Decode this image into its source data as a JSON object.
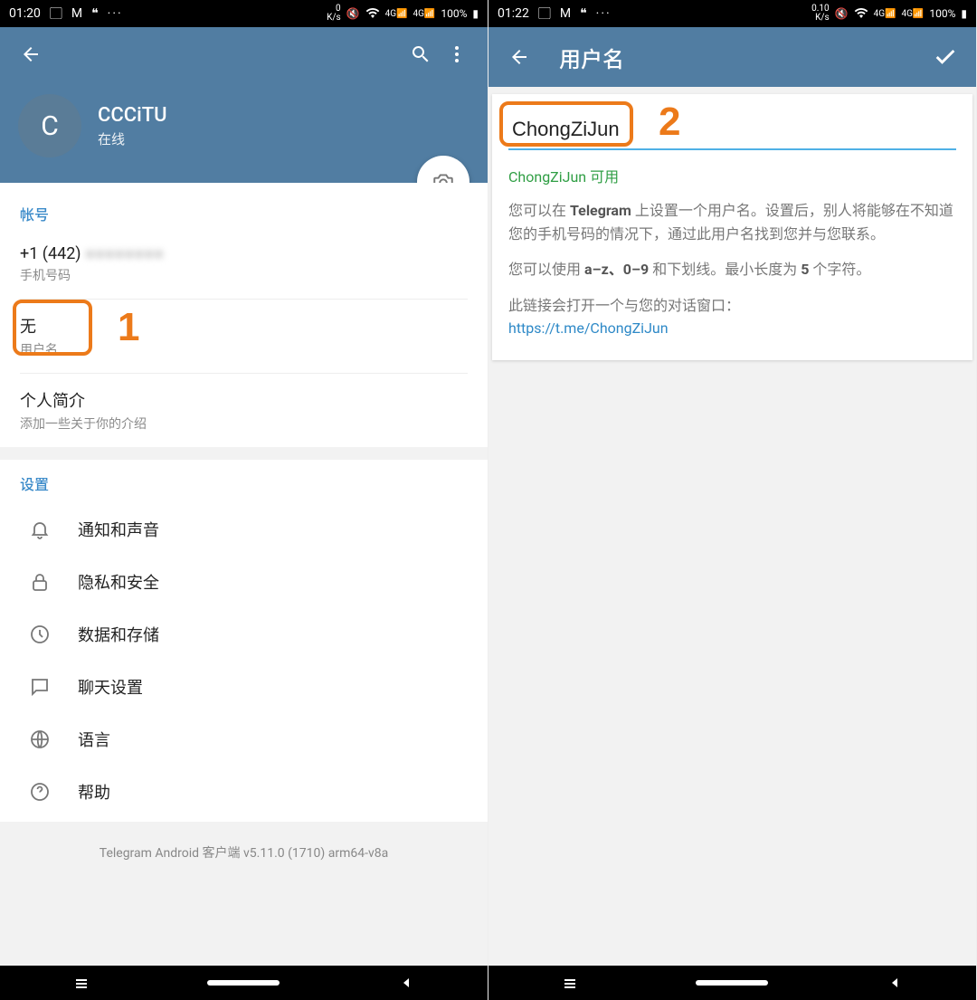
{
  "left": {
    "status": {
      "time": "01:20",
      "speed_top": "0",
      "speed_unit": "K/s",
      "net": "4G",
      "battery": "100%"
    },
    "profile": {
      "avatar_letter": "C",
      "name": "CCCiTU",
      "status": "在线"
    },
    "account": {
      "section_title": "帐号",
      "phone_value": "+1 (442)",
      "phone_hidden": "●●●●●●●●",
      "phone_label": "手机号码",
      "username_value": "无",
      "username_label": "用户名",
      "bio_value": "个人简介",
      "bio_label": "添加一些关于你的介绍"
    },
    "settings": {
      "section_title": "设置",
      "items": [
        {
          "label": "通知和声音",
          "icon": "bell-icon"
        },
        {
          "label": "隐私和安全",
          "icon": "lock-icon"
        },
        {
          "label": "数据和存储",
          "icon": "clock-icon"
        },
        {
          "label": "聊天设置",
          "icon": "chat-icon"
        },
        {
          "label": "语言",
          "icon": "globe-icon"
        },
        {
          "label": "帮助",
          "icon": "help-icon"
        }
      ]
    },
    "version": "Telegram Android 客户端 v5.11.0 (1710) arm64-v8a",
    "annotation_number": "1"
  },
  "right": {
    "status": {
      "time": "01:22",
      "speed_top": "0.10",
      "speed_unit": "K/s",
      "net": "4G",
      "battery": "100%"
    },
    "appbar_title": "用户名",
    "username_input": "ChongZiJun",
    "available_text": "ChongZiJun 可用",
    "desc_line1_a": "您可以在 ",
    "desc_line1_b": "Telegram",
    "desc_line1_c": " 上设置一个用户名。设置后，别人将能够在不知道您的手机号码的情况下，通过此用户名找到您并与您联系。",
    "desc_line2_a": "您可以使用 ",
    "desc_line2_b": "a–z、0–9",
    "desc_line2_c": " 和下划线。最小长度为 ",
    "desc_line2_d": "5",
    "desc_line2_e": " 个字符。",
    "desc_line3": "此链接会打开一个与您的对话窗口：",
    "link": "https://t.me/ChongZiJun",
    "annotation_number": "2"
  }
}
